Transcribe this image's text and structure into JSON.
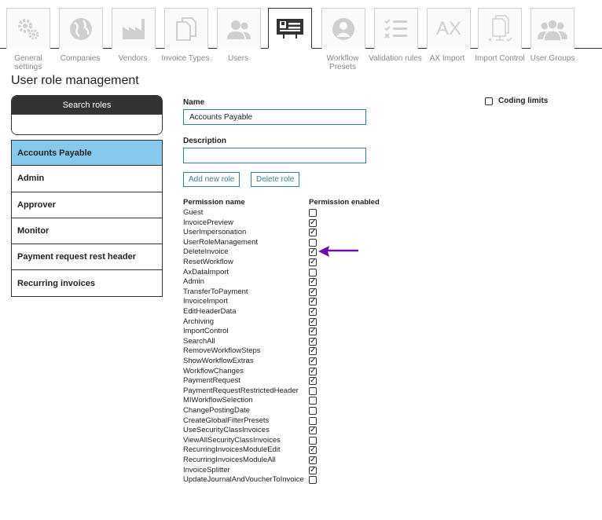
{
  "nav": {
    "tabs": [
      {
        "label": "General settings",
        "icon": "gears-icon"
      },
      {
        "label": "Companies",
        "icon": "globe-icon"
      },
      {
        "label": "Vendors",
        "icon": "factory-icon"
      },
      {
        "label": "Invoice Types",
        "icon": "documents-icon"
      },
      {
        "label": "Users",
        "icon": "users-icon"
      },
      {
        "label": "",
        "icon": "id-card-icon"
      },
      {
        "label": "Workflow Presets",
        "icon": "user-badge-icon"
      },
      {
        "label": "Validation rules",
        "icon": "checklist-icon"
      },
      {
        "label": "AX Import",
        "icon": "ax-text-icon",
        "icon_text": "AX"
      },
      {
        "label": "Import Control",
        "icon": "import-control-icon"
      },
      {
        "label": "User Groups",
        "icon": "user-group-icon"
      }
    ],
    "active_color": "#333333",
    "inactive_color": "#cccccc"
  },
  "page": {
    "title": "User role management"
  },
  "search": {
    "header": "Search roles",
    "value": ""
  },
  "roles": {
    "items": [
      "Accounts Payable",
      "Admin",
      "Approver",
      "Monitor",
      "Payment request rest header",
      "Recurring invoices"
    ],
    "selected_color": "#87c9ec"
  },
  "form": {
    "name_label": "Name",
    "name_value": "Accounts Payable",
    "description_label": "Description",
    "description_value": "",
    "add_button": "Add new role",
    "delete_button": "Delete role",
    "coding_limits_label": "Coding limits",
    "coding_limits_checked": false,
    "accent": "#3b7ea1"
  },
  "permissions": {
    "header_name": "Permission name",
    "header_enabled": "Permission enabled",
    "items": [
      {
        "name": "Guest",
        "enabled": false
      },
      {
        "name": "InvoicePreview",
        "enabled": true
      },
      {
        "name": "UserImpersonation",
        "enabled": true
      },
      {
        "name": "UserRoleManagement",
        "enabled": false
      },
      {
        "name": "DeleteInvoice",
        "enabled": true
      },
      {
        "name": "ResetWorkflow",
        "enabled": true
      },
      {
        "name": "AxDataImport",
        "enabled": false
      },
      {
        "name": "Admin",
        "enabled": true
      },
      {
        "name": "TransferToPayment",
        "enabled": true
      },
      {
        "name": "InvoiceImport",
        "enabled": true
      },
      {
        "name": "EditHeaderData",
        "enabled": true
      },
      {
        "name": "Archiving",
        "enabled": true
      },
      {
        "name": "ImportControl",
        "enabled": true
      },
      {
        "name": "SearchAll",
        "enabled": true
      },
      {
        "name": "RemoveWorkflowSteps",
        "enabled": true
      },
      {
        "name": "ShowWorkflowExtras",
        "enabled": true
      },
      {
        "name": "WorkflowChanges",
        "enabled": true
      },
      {
        "name": "PaymentRequest",
        "enabled": true
      },
      {
        "name": "PaymentRequestRestrictedHeader",
        "enabled": false
      },
      {
        "name": "MIWorkflowSelection",
        "enabled": false
      },
      {
        "name": "ChangePostingDate",
        "enabled": false
      },
      {
        "name": "CreateGlobalFilterPresets",
        "enabled": false
      },
      {
        "name": "UseSecurityClassInvoices",
        "enabled": true
      },
      {
        "name": "ViewAllSecurityClassInvoices",
        "enabled": false
      },
      {
        "name": "RecurringInvoicesModuleEdit",
        "enabled": true
      },
      {
        "name": "RecurringInvoicesModuleAll",
        "enabled": true
      },
      {
        "name": "InvoiceSplitter",
        "enabled": true
      },
      {
        "name": "UpdateJournalAndVoucherToInvoice",
        "enabled": false
      }
    ]
  },
  "annotation": {
    "arrow_color": "#6a0dad",
    "arrow_icon": "left-arrow-icon"
  }
}
